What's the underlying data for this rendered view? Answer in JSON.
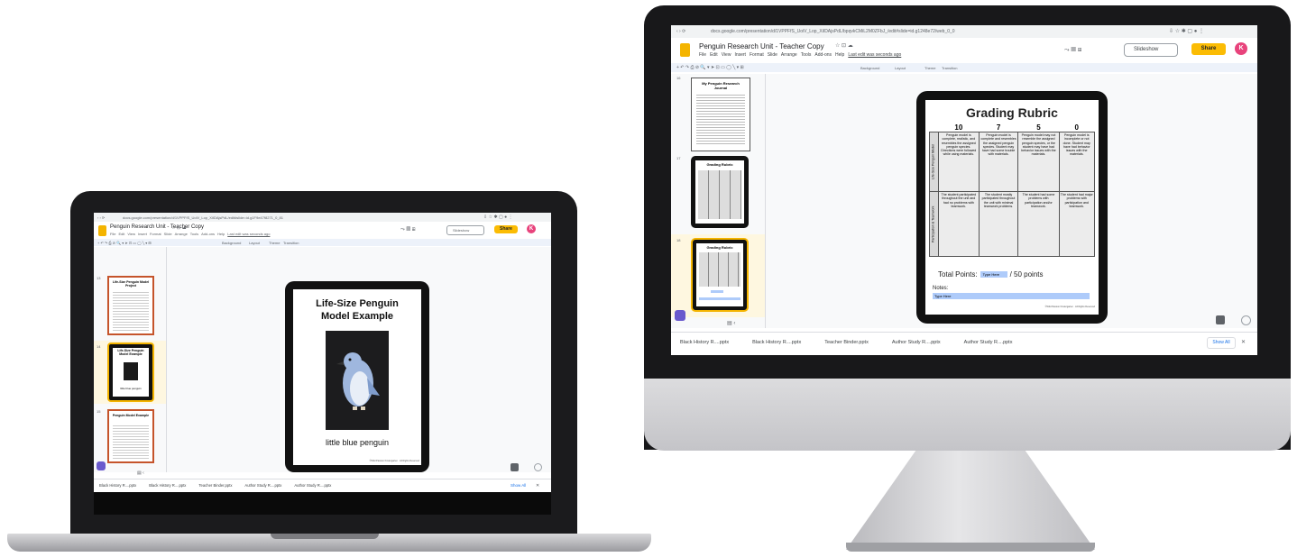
{
  "laptop": {
    "url": "docs.google.com/presentation/d/1VPPFfS_UoiV_Lop_XiIDAjsPdL/edit#slide=id.g1F9e47f8271_0_81",
    "doc_title": "Penguin Research Unit - Teacher Copy",
    "menu": [
      "File",
      "Edit",
      "View",
      "Insert",
      "Format",
      "Slide",
      "Arrange",
      "Tools",
      "Add-ons",
      "Help"
    ],
    "last_edit": "Last edit was seconds ago",
    "toolbar_items": [
      "Background",
      "Layout",
      "Theme",
      "Transition"
    ],
    "slideshow_label": "Slideshow",
    "share_label": "Share",
    "avatar_initial": "K",
    "thumbnails": [
      {
        "number": "13",
        "title": "Life-Size Penguin Model Project"
      },
      {
        "number": "14",
        "title": "Life-Size Penguin Model Example",
        "caption": "little blue penguin"
      },
      {
        "number": "15",
        "title": "Penguin Model Example"
      }
    ],
    "slide": {
      "title_line1": "Life-Size Penguin",
      "title_line2": "Model Example",
      "caption": "little blue penguin",
      "footer": "©Wild Passion Kindergarten · All Rights Reserved"
    },
    "downloads": [
      "Black History R....pptx",
      "Black History R....pptx",
      "Teacher Binder.pptx",
      "Author Study R....pptx",
      "Author Study R....pptx"
    ],
    "show_all": "Show All"
  },
  "monitor": {
    "url": "docs.google.com/presentation/d/1VPPFfS_UoiV_Lop_XiIDAjsPdL/bpqvkCMiL2M0ZFbJ_/edit#slide=id.g1248e72/web_0_0",
    "doc_title": "Penguin Research Unit - Teacher Copy",
    "menu": [
      "File",
      "Edit",
      "View",
      "Insert",
      "Format",
      "Slide",
      "Arrange",
      "Tools",
      "Add-ons",
      "Help"
    ],
    "last_edit": "Last edit was seconds ago",
    "toolbar_items": [
      "Background",
      "Layout",
      "Theme",
      "Transition"
    ],
    "slideshow_label": "Slideshow",
    "share_label": "Share",
    "avatar_initial": "K",
    "thumbnails": [
      {
        "number": "16",
        "title": "My Penguin Research Journal"
      },
      {
        "number": "17",
        "title": "Grading Rubric"
      },
      {
        "number": "18",
        "title": "Grading Rubric"
      }
    ],
    "slide": {
      "title": "Grading Rubric",
      "scores": [
        "10",
        "7",
        "5",
        "0"
      ],
      "rows": [
        {
          "label": "Life-Size Penguin Model",
          "cells": [
            "Penguin model is complete, realistic, and resembles the assigned penguin species. Directions were followed while using materials.",
            "Penguin model is complete and resembles the assigned penguin species. Student may have had some trouble with materials.",
            "Penguin model may not resemble the assigned penguin species, or the student may have had behavior issues with the materials.",
            "Penguin model is incomplete or not done. Student may have had behavior issues with the materials."
          ]
        },
        {
          "label": "Participation & Teamwork",
          "cells": [
            "The student participated throughout the unit and had no problems with teamwork.",
            "The student mostly participated throughout the unit with minimal teamwork problems.",
            "The student had some problems with participation and/or teamwork.",
            "The student had major problems with participation and teamwork."
          ]
        }
      ],
      "total_label": "Total Points:",
      "total_input": "Type Here",
      "total_suffix": "/ 50 points",
      "notes_label": "Notes:",
      "notes_input": "Type Here",
      "footer": "©Wild Passion Kindergarten · All Rights Reserved"
    },
    "downloads": [
      "Black History R....pptx",
      "Black History R....pptx",
      "Teacher Binder.pptx",
      "Author Study R....pptx",
      "Author Study R....pptx"
    ],
    "show_all": "Show All"
  },
  "colors": {
    "share": "#fbbc04",
    "avatar": "#e8437c",
    "selected_thumb": "#f4b400",
    "logo": "#f4b400"
  }
}
